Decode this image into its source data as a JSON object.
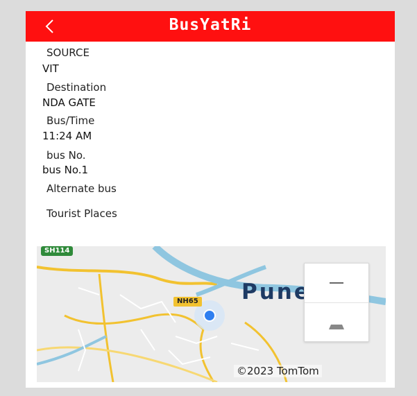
{
  "header": {
    "title": "BusYatRi"
  },
  "fields": {
    "source_label": "SOURCE",
    "source_value": "VIT",
    "destination_label": "Destination",
    "destination_value": "NDA GATE",
    "bus_time_label": "Bus/Time",
    "bus_time_value": "11:24 AM",
    "bus_no_label": "bus No.",
    "bus_no_value": "bus No.1",
    "alternate_bus_label": "Alternate bus",
    "tourist_places_label": "Tourist Places"
  },
  "map": {
    "city_label": "Pune Cit",
    "highway_sh": "SH114",
    "highway_nh": "NH65",
    "copyright": "©2023 TomTom",
    "colors": {
      "accent": "#ff1010",
      "location_dot": "#2f7ff0",
      "river": "#8fc6e0",
      "road_major": "#f2c230"
    }
  },
  "icons": {
    "back": "chevron-left-icon",
    "zoom_out": "minus-icon",
    "tilt": "tilt-icon"
  }
}
